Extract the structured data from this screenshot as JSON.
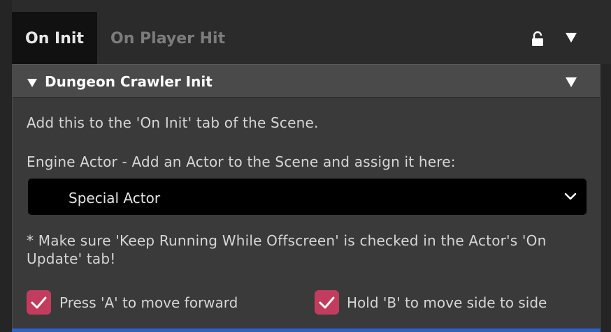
{
  "tabs": {
    "active": "On Init",
    "inactive": "On Player Hit"
  },
  "icons": {
    "lock": "lock-open-icon",
    "menu": "dropdown-caret-icon"
  },
  "section": {
    "title": "Dungeon Crawler Init"
  },
  "body": {
    "instruction": "Add this to the 'On Init' tab of the Scene.",
    "engine_label": "Engine Actor - Add an Actor to the Scene and assign it here:",
    "actor_select_value": "Special Actor",
    "note": "* Make sure 'Keep Running While Offscreen' is checked in the Actor's 'On Update' tab!"
  },
  "checkboxes": [
    {
      "label": "Press 'A' to move forward",
      "checked": true
    },
    {
      "label": "Hold 'B' to move side to side",
      "checked": true
    }
  ],
  "colors": {
    "accent": "#c23c5e",
    "focus_bar": "#2f62c8"
  }
}
